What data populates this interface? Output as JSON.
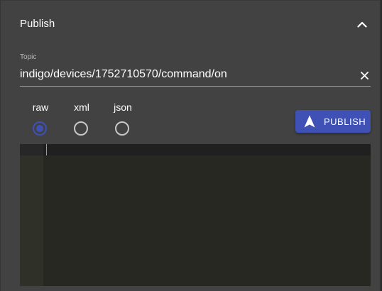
{
  "header": {
    "title": "Publish",
    "collapse_icon": "chevron-up-icon"
  },
  "topic": {
    "label": "Topic",
    "value": "indigo/devices/1752710570/command/on",
    "clear_icon": "close-icon"
  },
  "formats": [
    {
      "label": "raw",
      "selected": true
    },
    {
      "label": "xml",
      "selected": false
    },
    {
      "label": "json",
      "selected": false
    }
  ],
  "publish_button": {
    "label": "PUBLISH",
    "icon": "navigation-arrow-icon"
  },
  "editor": {
    "content": ""
  },
  "colors": {
    "panel": "#424242",
    "accent": "#3f51b5",
    "editor_bg": "#272822"
  }
}
